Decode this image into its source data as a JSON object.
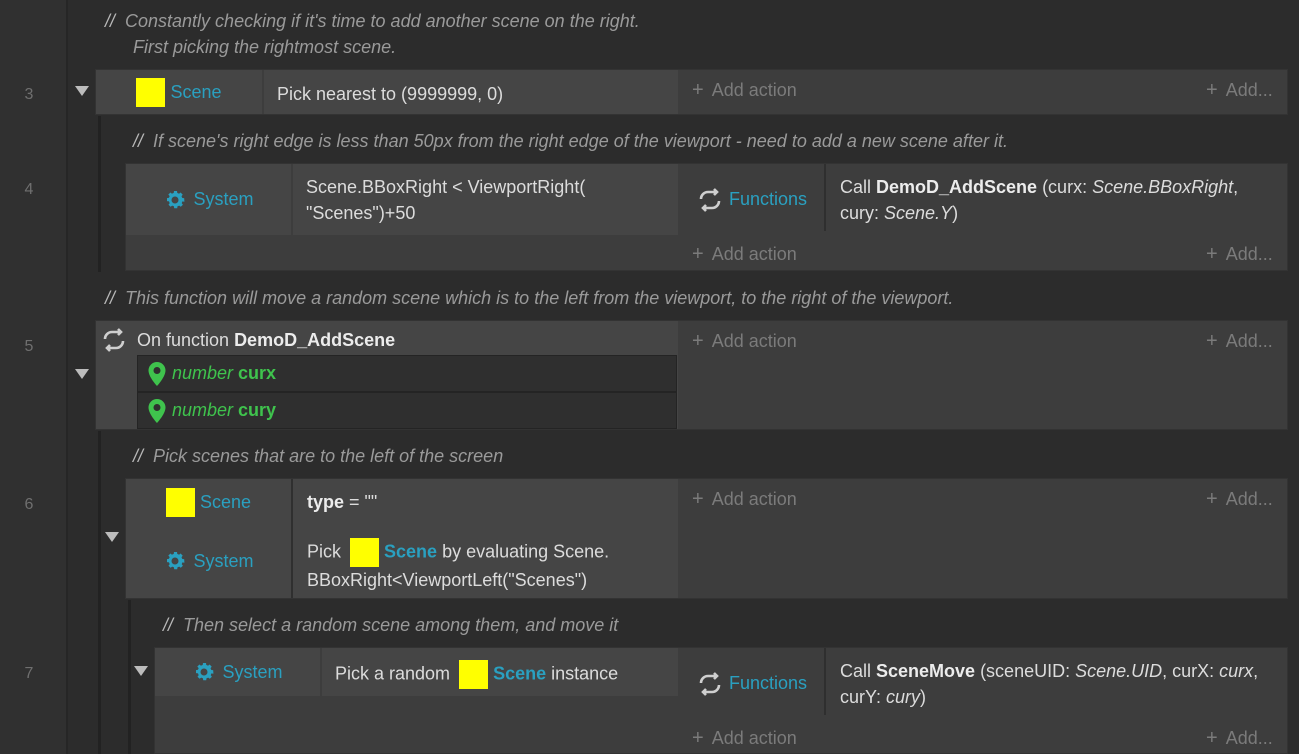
{
  "events": {
    "c1_line1": "Constantly checking if it's time to add another scene on the right.",
    "c1_line2": "First picking the rightmost scene.",
    "e3": {
      "num": "3",
      "obj": "Scene",
      "cond": "Pick nearest to (9999999, 0)"
    },
    "c2": "If scene's right edge is less than 50px from the right edge of the viewport - need to add a new scene after it.",
    "e4": {
      "num": "4",
      "obj": "System",
      "cond_l1": "Scene.BBoxRight < ViewportRight(",
      "cond_l2": "\"Scenes\")+50",
      "act_obj": "Functions",
      "act_call": "Call ",
      "act_fn": "DemoD_AddScene",
      "act_p1": " (curx: ",
      "act_p1v": "Scene.BBoxRight",
      "act_p1end": ",",
      "act_p2": "cury: ",
      "act_p2v": "Scene.Y",
      "act_p2end": ")"
    },
    "c3": "This function will move a random scene which is to the left from the viewport, to the right of the viewport.",
    "e5": {
      "num": "5",
      "on_function": "On function ",
      "fn_name": "DemoD_AddScene",
      "params": [
        {
          "type": "number",
          "name": "curx"
        },
        {
          "type": "number",
          "name": "cury"
        }
      ]
    },
    "c4": "Pick scenes that are to the left of the screen",
    "e6": {
      "num": "6",
      "cond1_obj": "Scene",
      "cond1_key": "type",
      "cond1_rest": " = \"\"",
      "cond2_obj": "System",
      "cond2_pick": "Pick ",
      "cond2_scene": "Scene",
      "cond2_rest": " by evaluating Scene.",
      "cond2_l2": "BBoxRight<ViewportLeft(\"Scenes\")"
    },
    "c5": "Then select a random scene among them, and move it",
    "e7": {
      "num": "7",
      "obj": "System",
      "cond_pick": "Pick a random ",
      "cond_scene": "Scene",
      "cond_rest": " instance",
      "act_obj": "Functions",
      "act_call": "Call ",
      "act_fn": "SceneMove",
      "act_p1": " (sceneUID: ",
      "act_p1v": "Scene.UID",
      "act_p2": ", curX: ",
      "act_p2v": "curx",
      "act_p2end": ",",
      "act_p3": "curY: ",
      "act_p3v": "cury",
      "act_p3end": ")"
    }
  },
  "common": {
    "comment_slashes": "//",
    "add_action": "Add action",
    "add_more": "Add..."
  },
  "colors": {
    "background": "#2c2c2c",
    "block": "#3d3d3d",
    "cell": "#454545",
    "object_blue": "#2aa0c0",
    "param_green": "#3fc34d",
    "scene_yellow": "#ffff00"
  },
  "icons": [
    "gear-icon",
    "functions-icon",
    "map-pin-icon",
    "expand-triangle-icon",
    "plus-icon"
  ]
}
